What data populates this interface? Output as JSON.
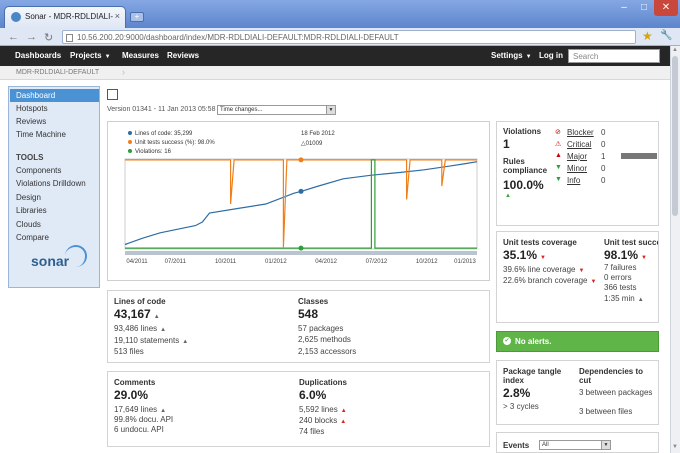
{
  "browser": {
    "tab_title": "Sonar - MDR-RDLDIALI-...",
    "tab_close": "×",
    "new_tab": "+",
    "url": "10.56.200.20:9000/dashboard/index/MDR-RDLDIALI-DEFAULT:MDR-RDLDIALI-DEFAULT",
    "controls": {
      "min": "–",
      "max": "□",
      "close": "✕"
    },
    "nav": {
      "back": "←",
      "forward": "→",
      "reload": "↻"
    },
    "icons": {
      "star": "★",
      "wrench": "🔧"
    }
  },
  "nav": {
    "dashboards": "Dashboards",
    "projects": "Projects",
    "measures": "Measures",
    "reviews": "Reviews",
    "settings": "Settings",
    "login": "Log in",
    "search_placeholder": "Search",
    "caret": "▼"
  },
  "breadcrumb": {
    "project": "MDR-RDLDIALI-DEFAULT",
    "arrow": "›"
  },
  "sidebar": {
    "items": [
      "Dashboard",
      "Hotspots",
      "Reviews",
      "Time Machine"
    ],
    "tools_heading": "TOOLS",
    "tools": [
      "Components",
      "Violations Drilldown",
      "Design",
      "Libraries",
      "Clouds",
      "Compare"
    ],
    "logo": "sonar"
  },
  "header": {
    "version": "Version 01341 - 11 Jan 2013 05:58",
    "time_select": "Time changes..."
  },
  "chart_data": {
    "type": "line",
    "legend": [
      {
        "name": "Lines of code: 35,299",
        "color": "#2e6da4"
      },
      {
        "name": "Unit tests success (%): 98.0%",
        "color": "#f07f1a"
      },
      {
        "name": "Violations: 16",
        "color": "#2e9e3a"
      }
    ],
    "date_label": "18 Feb 2012",
    "version_label": "01009",
    "x_ticks": [
      "04/2011",
      "07/2011",
      "10/2011",
      "01/2012",
      "04/2012",
      "07/2012",
      "10/2012",
      "01/2013"
    ],
    "series": [
      {
        "name": "Lines of code: 35,299",
        "color": "#2e6da4",
        "values": [
          [
            0,
            0.05
          ],
          [
            0.05,
            0.12
          ],
          [
            0.1,
            0.18
          ],
          [
            0.15,
            0.22
          ],
          [
            0.2,
            0.26
          ],
          [
            0.22,
            0.3
          ],
          [
            0.24,
            0.4
          ],
          [
            0.32,
            0.45
          ],
          [
            0.4,
            0.5
          ],
          [
            0.48,
            0.62
          ],
          [
            0.5,
            0.64
          ],
          [
            0.55,
            0.7
          ],
          [
            0.62,
            0.78
          ],
          [
            0.7,
            0.82
          ],
          [
            0.78,
            0.85
          ],
          [
            0.85,
            0.88
          ],
          [
            0.92,
            0.92
          ],
          [
            0.97,
            0.95
          ],
          [
            1.0,
            0.97
          ]
        ]
      },
      {
        "name": "Unit tests success (%): 98.0%",
        "color": "#f07f1a",
        "values": [
          [
            0,
            0.99
          ],
          [
            0.3,
            0.99
          ],
          [
            0.3,
            0.5
          ],
          [
            0.31,
            0.99
          ],
          [
            0.45,
            0.99
          ],
          [
            0.45,
            0.02
          ],
          [
            0.46,
            0.99
          ],
          [
            0.7,
            0.99
          ],
          [
            0.8,
            0.99
          ],
          [
            0.8,
            0.55
          ],
          [
            0.81,
            0.99
          ],
          [
            0.9,
            0.99
          ],
          [
            0.9,
            0.7
          ],
          [
            0.91,
            0.99
          ],
          [
            1.0,
            0.99
          ]
        ]
      },
      {
        "name": "Violations: 16",
        "color": "#2e9e3a",
        "values": [
          [
            0,
            0.01
          ],
          [
            0.7,
            0.01
          ],
          [
            0.7,
            0.99
          ],
          [
            0.71,
            0.99
          ],
          [
            0.71,
            0.01
          ],
          [
            1.0,
            0.01
          ]
        ]
      }
    ]
  },
  "violations": {
    "title": "Violations",
    "count": "1",
    "compliance_title": "Rules compliance",
    "compliance_value": "100.0%",
    "compliance_trend": "▲",
    "severities": [
      {
        "name": "Blocker",
        "count": "0",
        "icon": "⊘",
        "color": "#c00"
      },
      {
        "name": "Critical",
        "count": "0",
        "icon": "⚠",
        "color": "#c00"
      },
      {
        "name": "Major",
        "count": "1",
        "icon": "▲",
        "color": "#c00"
      },
      {
        "name": "Minor",
        "count": "0",
        "icon": "▼",
        "color": "#2e9e3a"
      },
      {
        "name": "Info",
        "count": "0",
        "icon": "▼",
        "color": "#2e9e3a"
      }
    ],
    "major_bar_fraction": 1.0
  },
  "loc": {
    "title": "Lines of code",
    "value": "43,167",
    "lines": "93,486 lines",
    "statements": "19,110 statements",
    "files": "513 files",
    "trend": "▲"
  },
  "classes": {
    "title": "Classes",
    "value": "548",
    "packages": "57 packages",
    "methods": "2,625 methods",
    "accessors": "2,153 accessors"
  },
  "coverage": {
    "title": "Unit tests coverage",
    "value": "35.1%",
    "line": "39.6% line coverage",
    "branch": "22.6% branch coverage",
    "trend": "▼"
  },
  "unit_tests": {
    "title": "Unit test success",
    "value": "98.1%",
    "failures": "7 failures",
    "errors": "0 errors",
    "tests": "366 tests",
    "time": "1:35 min",
    "trend": "▼"
  },
  "comments": {
    "title": "Comments",
    "value": "29.0%",
    "lines": "17,649 lines",
    "docu": "99.8% docu. API",
    "undocu": "6 undocu. API",
    "trend": "▲"
  },
  "duplications": {
    "title": "Duplications",
    "value": "6.0%",
    "lines": "5,592 lines",
    "blocks": "240 blocks",
    "files": "74 files",
    "trend": "▲"
  },
  "alerts": {
    "text": "No alerts.",
    "check": "✔"
  },
  "tangle": {
    "title": "Package tangle index",
    "value": "2.8%",
    "cycles": "> 3 cycles"
  },
  "dependencies": {
    "title": "Dependencies to cut",
    "packages": "3 between packages",
    "files": "3 between files"
  },
  "events": {
    "title": "Events",
    "select": "All"
  }
}
